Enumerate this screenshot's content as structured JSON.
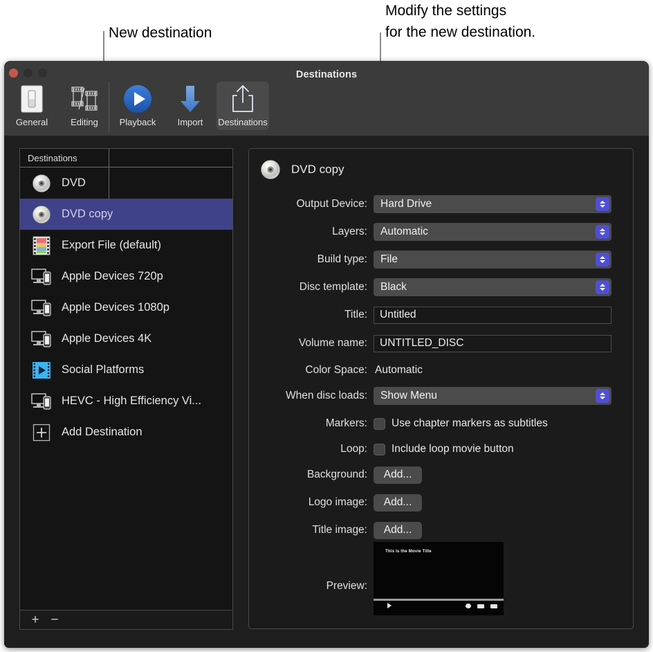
{
  "annotations": [
    {
      "id": "new-destination",
      "text": "New destination"
    },
    {
      "id": "modify-settings",
      "line1": "Modify the settings",
      "line2": "for the new destination."
    }
  ],
  "window": {
    "title": "Destinations",
    "traffic_lights": [
      "close-button",
      "minimize-button",
      "zoom-button"
    ]
  },
  "toolbar": {
    "items": [
      {
        "label": "General",
        "icon": "general-prefs-icon",
        "selected": false
      },
      {
        "label": "Editing",
        "icon": "film-strip-icon",
        "selected": false
      },
      {
        "label": "Playback",
        "icon": "play-circle-icon",
        "selected": false
      },
      {
        "label": "Import",
        "icon": "down-arrow-icon",
        "selected": false
      },
      {
        "label": "Destinations",
        "icon": "share-up-arrow-icon",
        "selected": true
      }
    ]
  },
  "sidebar": {
    "header": "Destinations",
    "items": [
      {
        "label": "DVD",
        "icon": "disc-icon",
        "selected": false
      },
      {
        "label": "DVD copy",
        "icon": "disc-icon",
        "selected": true
      },
      {
        "label": "Export File (default)",
        "icon": "film-color-icon",
        "selected": false
      },
      {
        "label": "Apple Devices 720p",
        "icon": "devices-icon",
        "selected": false
      },
      {
        "label": "Apple Devices 1080p",
        "icon": "devices-icon",
        "selected": false
      },
      {
        "label": "Apple Devices 4K",
        "icon": "devices-icon",
        "selected": false
      },
      {
        "label": "Social Platforms",
        "icon": "social-video-icon",
        "selected": false
      },
      {
        "label": "HEVC - High Efficiency Vi...",
        "icon": "devices-icon",
        "selected": false
      },
      {
        "label": "Add Destination",
        "icon": "plus-box-icon",
        "selected": false
      }
    ],
    "footer": {
      "add": "+",
      "remove": "−"
    }
  },
  "detail": {
    "title": "DVD copy",
    "title_icon": "disc-icon",
    "fields": [
      {
        "label": "Output Device:",
        "type": "popup",
        "value": "Hard Drive"
      },
      {
        "label": "Layers:",
        "type": "popup",
        "value": "Automatic"
      },
      {
        "label": "Build type:",
        "type": "popup",
        "value": "File"
      },
      {
        "label": "Disc template:",
        "type": "popup",
        "value": "Black"
      },
      {
        "label": "Title:",
        "type": "text",
        "value": "Untitled"
      },
      {
        "label": "Volume name:",
        "type": "text",
        "value": "UNTITLED_DISC"
      },
      {
        "label": "Color Space:",
        "type": "static",
        "value": "Automatic"
      },
      {
        "label": "When disc loads:",
        "type": "popup",
        "value": "Show Menu"
      },
      {
        "label": "Markers:",
        "type": "checkbox",
        "value": "Use chapter markers as subtitles",
        "checked": false
      },
      {
        "label": "Loop:",
        "type": "checkbox",
        "value": "Include loop movie button",
        "checked": false
      },
      {
        "label": "Background:",
        "type": "button",
        "value": "Add..."
      },
      {
        "label": "Logo image:",
        "type": "button",
        "value": "Add..."
      },
      {
        "label": "Title image:",
        "type": "button",
        "value": "Add..."
      }
    ],
    "preview": {
      "label": "Preview:",
      "movie_title": "This is the Movie Title"
    }
  },
  "colors": {
    "selection": "#3f4288",
    "stepper": "#4f4fd4",
    "toolbar": "#3b3b3b",
    "window_bg": "#1e1e1e",
    "panel_bg": "#1b1b1b",
    "accent_blue": "#2c6fd0"
  }
}
